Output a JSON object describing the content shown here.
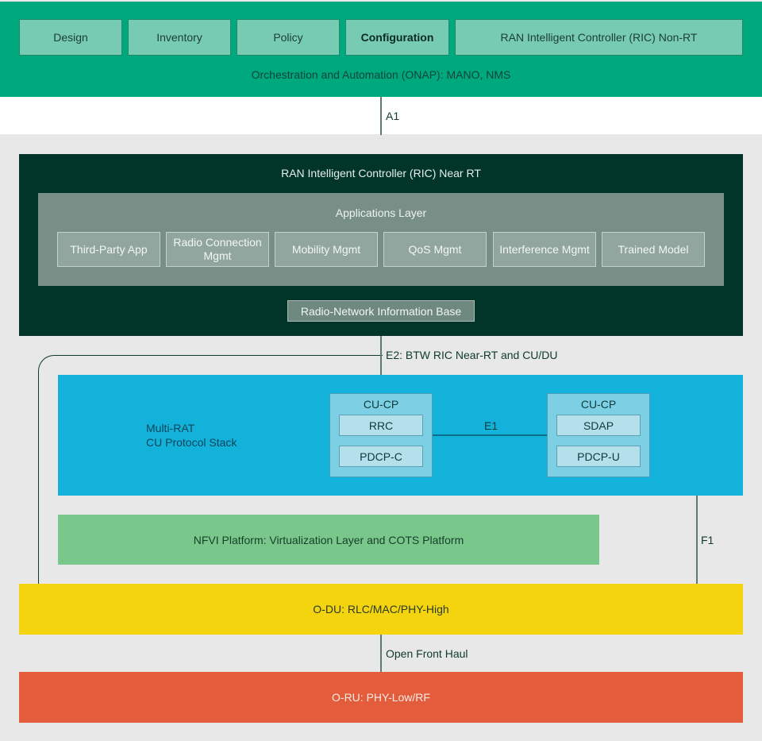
{
  "onap": {
    "tabs": [
      {
        "label": "Design",
        "active": false
      },
      {
        "label": "Inventory",
        "active": false
      },
      {
        "label": "Policy",
        "active": false
      },
      {
        "label": "Configuration",
        "active": true
      },
      {
        "label": "RAN Intelligent Controller (RIC) Non-RT",
        "active": false
      }
    ],
    "caption": "Orchestration and Automation (ONAP): MANO, NMS",
    "color": "#00a87e"
  },
  "interfaces": {
    "a1": "A1",
    "e2": "E2: BTW RIC Near-RT and CU/DU",
    "e1": "E1",
    "f1": "F1",
    "fronthaul": "Open Front Haul"
  },
  "ric_near_rt": {
    "title": "RAN Intelligent Controller (RIC) Near RT",
    "applications_layer": {
      "title": "Applications Layer",
      "apps": [
        "Third-Party App",
        "Radio Connection Mgmt",
        "Mobility Mgmt",
        "QoS Mgmt",
        "Interference Mgmt",
        "Trained Model"
      ]
    },
    "rnib": "Radio-Network Information Base",
    "color": "#013529"
  },
  "cu": {
    "label_line1": "Multi-RAT",
    "label_line2": "CU Protocol Stack",
    "color": "#12b2db",
    "boxes": [
      {
        "title": "CU-CP",
        "items": [
          "RRC",
          "PDCP-C"
        ]
      },
      {
        "title": "CU-CP",
        "items": [
          "SDAP",
          "PDCP-U"
        ]
      }
    ]
  },
  "nfvi": {
    "label": "NFVI Platform: Virtualization Layer and COTS Platform",
    "color": "#7ac78c"
  },
  "odu": {
    "label": "O-DU: RLC/MAC/PHY-High",
    "color": "#f4d40f"
  },
  "oru": {
    "label": "O-RU: PHY-Low/RF",
    "color": "#e35c3b"
  }
}
